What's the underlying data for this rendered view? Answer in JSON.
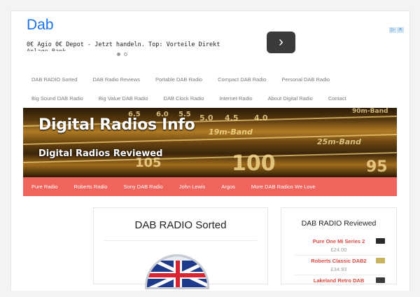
{
  "ad": {
    "title": "Dab",
    "text": "0€ Agio 0€ Depot - Jetzt handeln. Top: Vorteile Direkt",
    "text_cutoff": "Anlage Bank",
    "next_icon": "chevron-right-icon",
    "choices_icons": [
      "ad-info-icon",
      "ad-close-icon"
    ]
  },
  "topnav": {
    "row1": [
      "DAB RADIO Sorted",
      "DAB Radio Reviews",
      "Portable DAB Radio",
      "Compact DAB Radio",
      "Personal DAB Radio"
    ],
    "row2": [
      "Big Sound DAB Radio",
      "Big Value DAB Radio",
      "DAB Clock Radio",
      "Internet Radio",
      "About Digital Radio",
      "Contact"
    ]
  },
  "banner": {
    "title": "Digital Radios Info",
    "subtitle": "Digital Radios Reviewed",
    "dial_labels": [
      "6.5",
      "6.0",
      "5.5",
      "5.0",
      "4.5",
      "4.0",
      "90m-Band",
      "19m-Band",
      "25m-Band",
      "105",
      "100",
      "95"
    ]
  },
  "redmenu": {
    "items": [
      "Pure Radio",
      "Roberts Radio",
      "Sony DAB Radio",
      "John Lewis",
      "Argos",
      "More DAB Radios We Love"
    ],
    "color": "#ef645c"
  },
  "main": {
    "title": "DAB RADIO Sorted"
  },
  "sidebar": {
    "title": "DAB RADIO Reviewed",
    "items": [
      {
        "name": "Pure One Mi Series 2",
        "price": "£24.00",
        "thumb_color": "#2a2a2a"
      },
      {
        "name": "Roberts Classic DAB2",
        "price": "£34.93",
        "thumb_color": "#c9b35c"
      },
      {
        "name": "Lakeland Retro DAB",
        "price": "",
        "thumb_color": "#3a3a3a"
      }
    ]
  },
  "colors": {
    "accent": "#ef645c",
    "link_red": "#e24a43",
    "ad_blue": "#1a73e8"
  }
}
